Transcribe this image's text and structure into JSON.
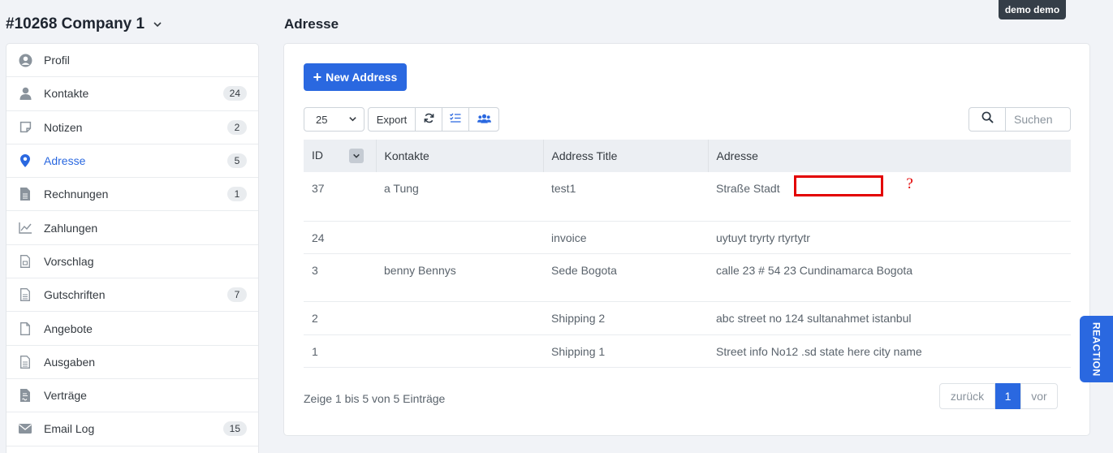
{
  "company": {
    "title": "#10268 Company 1"
  },
  "user": {
    "name": "demo demo"
  },
  "page": {
    "title": "Adresse"
  },
  "sidebar": {
    "items": [
      {
        "label": "Profil",
        "icon": "user-circle-icon",
        "badge": ""
      },
      {
        "label": "Kontakte",
        "icon": "user-icon",
        "badge": "24"
      },
      {
        "label": "Notizen",
        "icon": "note-icon",
        "badge": "2"
      },
      {
        "label": "Adresse",
        "icon": "map-pin-icon",
        "badge": "5",
        "active": true
      },
      {
        "label": "Rechnungen",
        "icon": "file-text-icon",
        "badge": "1"
      },
      {
        "label": "Zahlungen",
        "icon": "chart-line-icon",
        "badge": ""
      },
      {
        "label": "Vorschlag",
        "icon": "file-doc-icon",
        "badge": ""
      },
      {
        "label": "Gutschriften",
        "icon": "file-lines-icon",
        "badge": "7"
      },
      {
        "label": "Angebote",
        "icon": "file-blank-icon",
        "badge": ""
      },
      {
        "label": "Ausgaben",
        "icon": "file-lines-icon",
        "badge": ""
      },
      {
        "label": "Verträge",
        "icon": "file-contract-icon",
        "badge": ""
      },
      {
        "label": "Email Log",
        "icon": "envelope-icon",
        "badge": "15"
      }
    ]
  },
  "actions": {
    "new_address": "New Address"
  },
  "toolbar": {
    "page_size": "25",
    "export": "Export"
  },
  "search": {
    "placeholder": "Suchen"
  },
  "table": {
    "headers": [
      "ID",
      "Kontakte",
      "Address Title",
      "Adresse"
    ],
    "rows": [
      {
        "id": "37",
        "kontakt": "a Tung",
        "title": "test1",
        "adresse": "Straße Stadt",
        "annotation": "?"
      },
      {
        "id": "24",
        "kontakt": "",
        "title": "invoice",
        "adresse": "uytuyt tryrty rtyrtytr"
      },
      {
        "id": "3",
        "kontakt": "benny Bennys",
        "title": "Sede Bogota",
        "adresse": "calle 23 # 54 23 Cundinamarca Bogota"
      },
      {
        "id": "2",
        "kontakt": "",
        "title": "Shipping 2",
        "adresse": "abc street no 124 sultanahmet istanbul"
      },
      {
        "id": "1",
        "kontakt": "",
        "title": "Shipping 1",
        "adresse": "Street info No12 .sd state here city name"
      }
    ]
  },
  "footer": {
    "info": "Zeige 1 bis 5 von 5 Einträge",
    "prev": "zurück",
    "current_page": "1",
    "next": "vor"
  },
  "reaction": {
    "label": "REACTION"
  },
  "colors": {
    "accent": "#2a68e0",
    "annotation": "#e30000"
  }
}
